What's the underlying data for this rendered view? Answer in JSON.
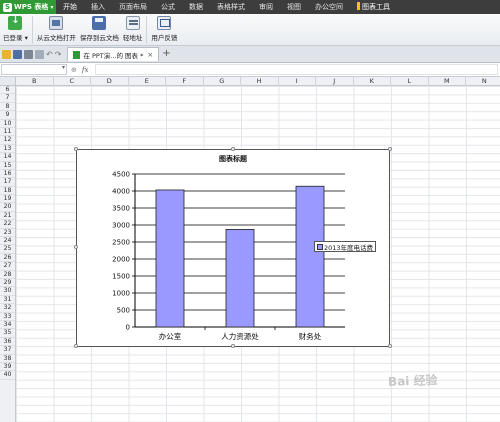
{
  "app": {
    "logo_text": "WPS 表格",
    "menu": [
      "开始",
      "插入",
      "页面布局",
      "公式",
      "数据",
      "表格样式",
      "审阅",
      "视图",
      "办公空间"
    ],
    "chart_tools_label": "图表工具"
  },
  "ribbon": {
    "buttons": [
      {
        "label": "已登录",
        "icon": "login-icon"
      },
      {
        "label": "从云文档打开",
        "icon": "cloud-open-icon"
      },
      {
        "label": "保存到云文档",
        "icon": "cloud-save-icon"
      },
      {
        "label": "轻地址",
        "icon": "address-icon"
      },
      {
        "label": "用户反馈",
        "icon": "feedback-icon"
      }
    ]
  },
  "tabs": {
    "document_tab": "在 PPT演...的 图表 *",
    "new_tab_symbol": "+"
  },
  "formula_bar": {
    "fx_label": "fx",
    "name_box_value": "",
    "formula_value": ""
  },
  "grid": {
    "columns": [
      "B",
      "C",
      "D",
      "E",
      "F",
      "G",
      "H",
      "I",
      "J",
      "K",
      "L",
      "M",
      "N"
    ],
    "rows": [
      "6",
      "7",
      "8",
      "9",
      "10",
      "11",
      "12",
      "13",
      "14",
      "15",
      "16",
      "17",
      "18",
      "19",
      "20",
      "21",
      "22",
      "23",
      "24",
      "25",
      "26",
      "27",
      "28",
      "29",
      "30",
      "31",
      "32",
      "33",
      "34",
      "35",
      "36",
      "37",
      "38",
      "39",
      "40"
    ]
  },
  "chart_data": {
    "type": "bar",
    "title": "图表标题",
    "categories": [
      "办公室",
      "人力资源处",
      "财务处"
    ],
    "series": [
      {
        "name": "2013年度电话费",
        "values": [
          4030,
          2870,
          4140
        ]
      }
    ],
    "ylim": [
      0,
      4500
    ],
    "yticks": [
      0,
      500,
      1000,
      1500,
      2000,
      2500,
      3000,
      3500,
      4000,
      4500
    ],
    "grid": true,
    "legend_position": "right",
    "bar_color": "#9999ff"
  },
  "watermark_text": "Bai 经验"
}
